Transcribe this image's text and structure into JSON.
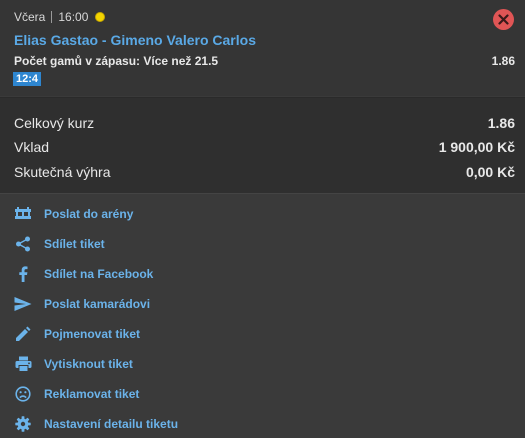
{
  "ticket": {
    "day": "Včera",
    "time": "16:00",
    "match": "Elias Gastao - Gimeno Valero Carlos",
    "market": "Počet gamů v zápasu: Více než 21.5",
    "odd": "1.86",
    "score": "12:4"
  },
  "summary": [
    {
      "label": "Celkový kurz",
      "value": "1.86"
    },
    {
      "label": "Vklad",
      "value": "1 900,00 Kč"
    },
    {
      "label": "Skutečná výhra",
      "value": "0,00 Kč"
    }
  ],
  "actions": [
    {
      "label": "Poslat do arény",
      "icon": "arena-icon"
    },
    {
      "label": "Sdílet tiket",
      "icon": "share-icon"
    },
    {
      "label": "Sdílet na Facebook",
      "icon": "facebook-icon"
    },
    {
      "label": "Poslat kamarádovi",
      "icon": "send-icon"
    },
    {
      "label": "Pojmenovat tiket",
      "icon": "pencil-icon"
    },
    {
      "label": "Vytisknout tiket",
      "icon": "printer-icon"
    },
    {
      "label": "Reklamovat tiket",
      "icon": "sad-face-icon"
    },
    {
      "label": "Nastavení detailu tiketu",
      "icon": "gear-icon"
    }
  ],
  "colors": {
    "link": "#6bb3ea",
    "match": "#5aa9e6",
    "close": "#e05555",
    "score_bg": "#2e86d0",
    "coin": "#f3d400"
  }
}
